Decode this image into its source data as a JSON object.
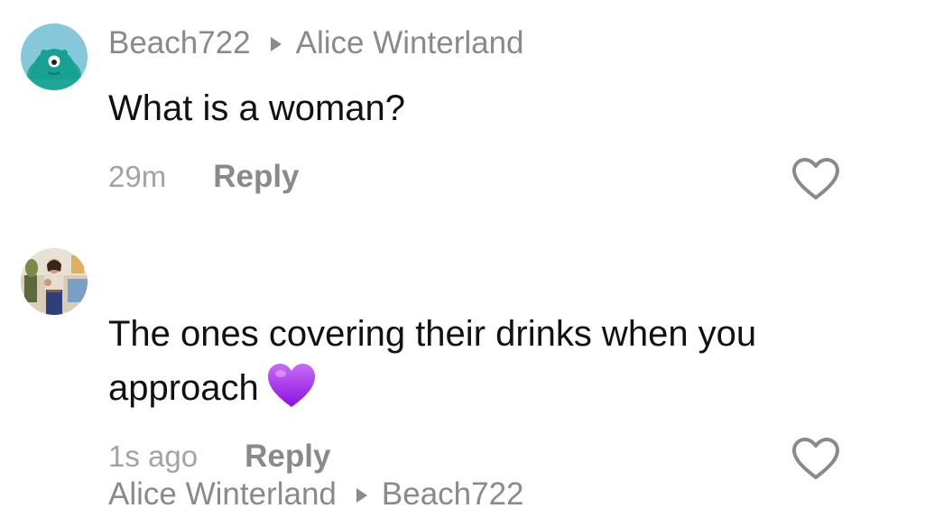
{
  "comments": [
    {
      "author": "Beach722",
      "reply_to": "Alice Winterland",
      "text": "What is a woman?",
      "time": "29m",
      "reply_label": "Reply",
      "avatar_icon": "teal-monster-avatar",
      "avatar_bg": "#6ec6d6"
    },
    {
      "author": "Alice Winterland",
      "reply_to": "Beach722",
      "text_line1": "The ones covering their drinks when you",
      "text_line2": "approach",
      "emoji": "purple-heart-icon",
      "time": "1s ago",
      "reply_label": "Reply",
      "avatar_icon": "photo-avatar"
    }
  ],
  "colors": {
    "meta_gray": "#8a8a8a",
    "time_gray": "#a3a3a3",
    "text": "#111111",
    "heart_purple": "#a020f0"
  }
}
